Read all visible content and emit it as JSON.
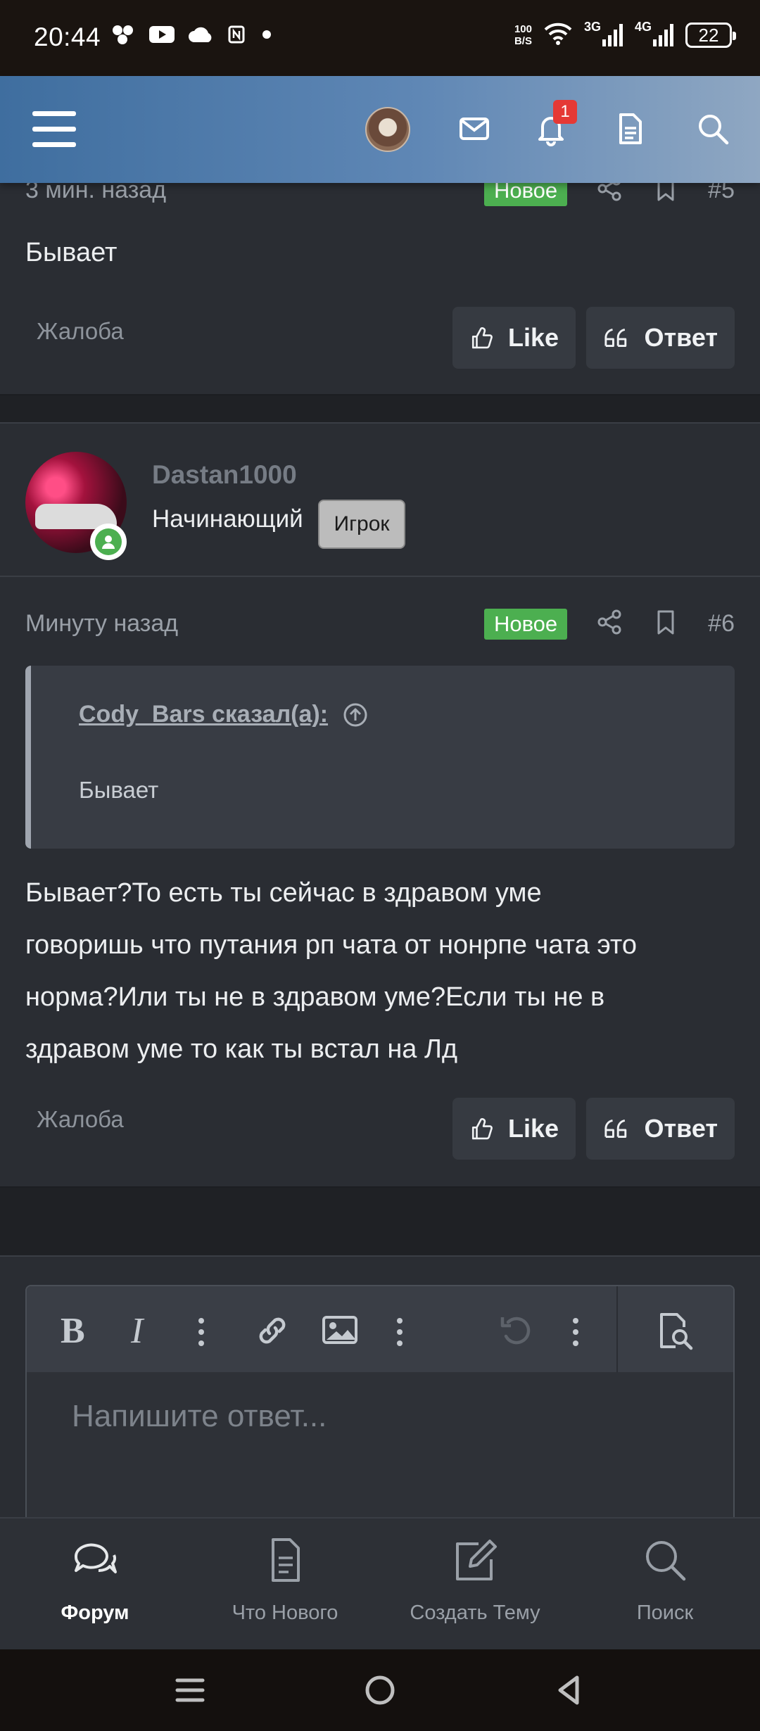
{
  "status_bar": {
    "time": "20:44",
    "speed_value": "100",
    "speed_unit": "B/S",
    "net1": "3G",
    "net2": "4G",
    "battery": "22"
  },
  "header": {
    "notification_count": "1"
  },
  "prev_post": {
    "time": "3 мин. назад",
    "new_label": "Новое",
    "number": "#5",
    "text": "Бывает",
    "report": "Жалоба",
    "like": "Like",
    "reply": "Ответ"
  },
  "user": {
    "name": "Dastan1000",
    "title": "Начинающий",
    "role": "Игрок"
  },
  "post": {
    "time": "Минуту назад",
    "new_label": "Новое",
    "number": "#6",
    "quote_author": "Cody_Bars сказал(а):",
    "quote_text": "Бывает",
    "lines": [
      "Бывает?То есть ты сейчас в здравом уме",
      "говоришь что путания рп чата от нонрпе чата это",
      "норма?Или ты не в здравом уме?Если ты не в",
      "здравом уме то как ты встал на Лд"
    ],
    "report": "Жалоба",
    "like": "Like",
    "reply": "Ответ"
  },
  "editor": {
    "placeholder": "Напишите ответ..."
  },
  "bottom_nav": {
    "items": [
      {
        "label": "Форум",
        "icon": "chat-bubbles-icon"
      },
      {
        "label": "Что Нового",
        "icon": "document-icon"
      },
      {
        "label": "Создать Тему",
        "icon": "edit-icon"
      },
      {
        "label": "Поиск",
        "icon": "search-icon"
      }
    ]
  },
  "colors": {
    "accent_new": "#4caf50",
    "header_gradient_start": "#3f6e9f",
    "badge_red": "#e53935",
    "background": "#2a2d33"
  }
}
